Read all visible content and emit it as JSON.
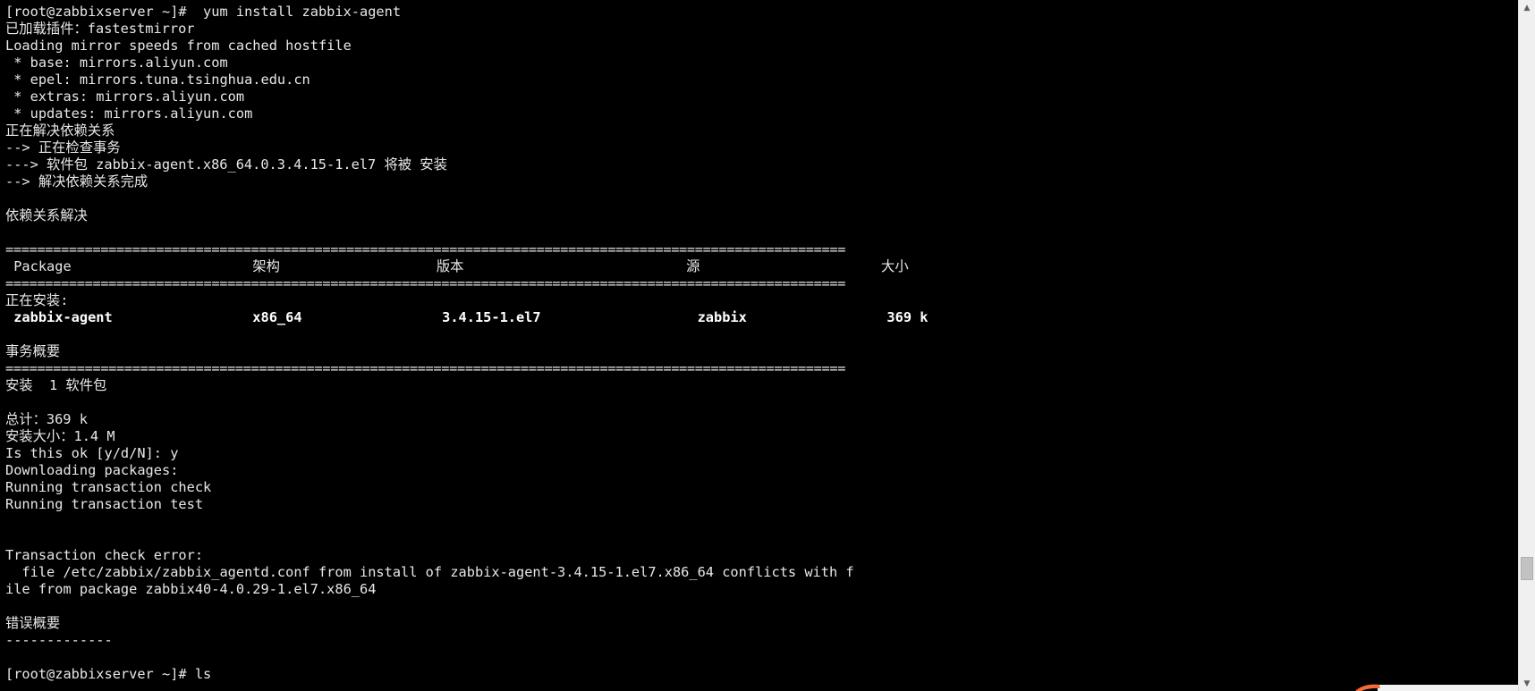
{
  "terminal": {
    "lines": [
      {
        "text": "[root@zabbixserver ~]#  yum install zabbix-agent"
      },
      {
        "text": "已加载插件：fastestmirror"
      },
      {
        "text": "Loading mirror speeds from cached hostfile"
      },
      {
        "text": " * base: mirrors.aliyun.com"
      },
      {
        "text": " * epel: mirrors.tuna.tsinghua.edu.cn"
      },
      {
        "text": " * extras: mirrors.aliyun.com"
      },
      {
        "text": " * updates: mirrors.aliyun.com"
      },
      {
        "text": "正在解决依赖关系"
      },
      {
        "text": "--> 正在检查事务"
      },
      {
        "text": "---> 软件包 zabbix-agent.x86_64.0.3.4.15-1.el7 将被 安装"
      },
      {
        "text": "--> 解决依赖关系完成"
      },
      {
        "text": ""
      },
      {
        "text": "依赖关系解决"
      },
      {
        "text": ""
      },
      {
        "text": "==========================================================================================================",
        "kind": "separator"
      },
      {
        "text": " Package                      架构                   版本                           源                      大小"
      },
      {
        "text": "==========================================================================================================",
        "kind": "separator"
      },
      {
        "text": "正在安装:"
      },
      {
        "text": " zabbix-agent                 x86_64                 3.4.15-1.el7                   zabbix                 369 k",
        "kind": "bold"
      },
      {
        "text": ""
      },
      {
        "text": "事务概要"
      },
      {
        "text": "==========================================================================================================",
        "kind": "separator"
      },
      {
        "text": "安装  1 软件包"
      },
      {
        "text": ""
      },
      {
        "text": "总计：369 k"
      },
      {
        "text": "安装大小：1.4 M"
      },
      {
        "text": "Is this ok [y/d/N]: y"
      },
      {
        "text": "Downloading packages:"
      },
      {
        "text": "Running transaction check"
      },
      {
        "text": "Running transaction test"
      },
      {
        "text": ""
      },
      {
        "text": ""
      },
      {
        "text": "Transaction check error:"
      },
      {
        "text": "  file /etc/zabbix/zabbix_agentd.conf from install of zabbix-agent-3.4.15-1.el7.x86_64 conflicts with f"
      },
      {
        "text": "ile from package zabbix40-4.0.29-1.el7.x86_64"
      },
      {
        "text": ""
      },
      {
        "text": "错误概要"
      },
      {
        "text": "-------------"
      },
      {
        "text": ""
      },
      {
        "text": "[root@zabbixserver ~]# ls"
      }
    ]
  },
  "scrollbar": {
    "up_icon": "triangle-up",
    "down_icon": "triangle-down",
    "position_fraction": 0.85
  },
  "colors": {
    "background": "#000000",
    "foreground": "#e8e8e8",
    "scrollbar_track": "#f0f0f0",
    "scrollbar_thumb": "#c2c2c2",
    "accent_orange": "#f26b38"
  }
}
